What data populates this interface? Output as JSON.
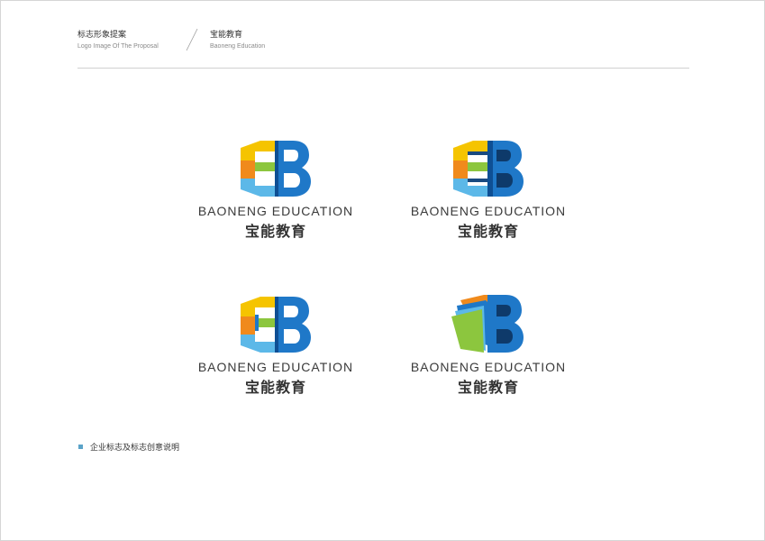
{
  "header": {
    "left_cn": "标志形象提案",
    "left_en": "Logo Image Of The Proposal",
    "right_cn": "宝能教育",
    "right_en": "Baoneng Education"
  },
  "logos": [
    {
      "en": "BAONENG EDUCATION",
      "cn": "宝能教育",
      "variant": "bars-hexagon"
    },
    {
      "en": "BAONENG EDUCATION",
      "cn": "宝能教育",
      "variant": "bars-hexagon-dark"
    },
    {
      "en": "BAONENG EDUCATION",
      "cn": "宝能教育",
      "variant": "bars-hexagon-outline"
    },
    {
      "en": "BAONENG EDUCATION",
      "cn": "宝能教育",
      "variant": "book-pages"
    }
  ],
  "caption": {
    "text": "企业标志及标志创意说明"
  },
  "colors": {
    "yellow": "#f5c400",
    "orange": "#f08a1c",
    "green": "#8cc63e",
    "light_blue": "#5cb8e8",
    "blue": "#1f78c8",
    "dark_blue": "#0e4f94",
    "bullet": "#5aa3c8"
  }
}
